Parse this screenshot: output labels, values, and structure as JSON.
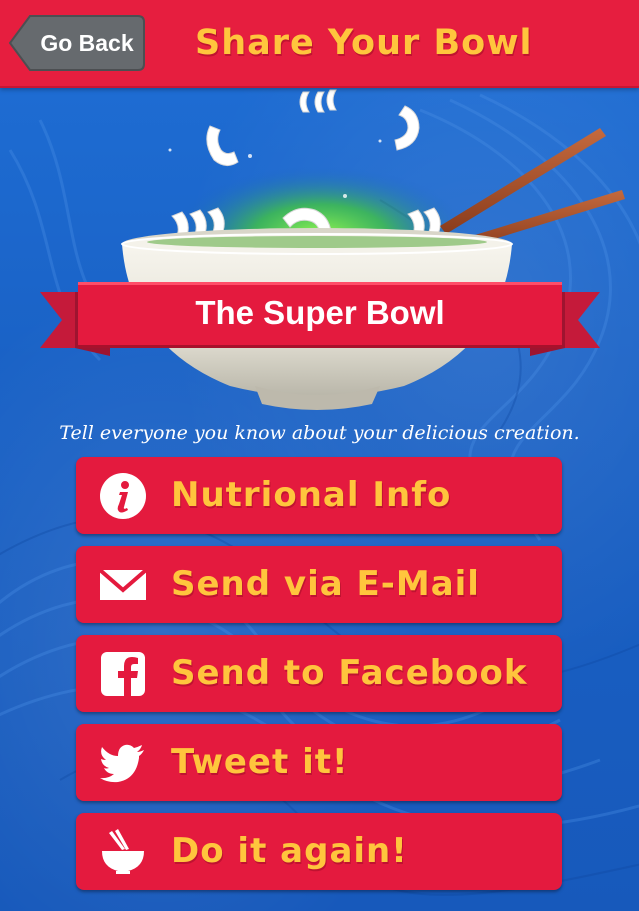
{
  "header": {
    "back_label": "Go Back",
    "title": "Share Your Bowl"
  },
  "bowl": {
    "name": "The Super Bowl"
  },
  "tagline": "Tell everyone you know about your delicious creation.",
  "actions": [
    {
      "label": "Nutrional Info",
      "icon": "info-icon"
    },
    {
      "label": "Send via E-Mail",
      "icon": "mail-icon"
    },
    {
      "label": "Send to Facebook",
      "icon": "facebook-icon"
    },
    {
      "label": "Tweet it!",
      "icon": "twitter-bird-icon"
    },
    {
      "label": "Do it again!",
      "icon": "bowl-chopsticks-icon"
    }
  ],
  "colors": {
    "header_red": "#e61e3f",
    "button_red": "#e41a3e",
    "label_yellow": "#ffc53d",
    "background_blue": "#1a63c5"
  }
}
